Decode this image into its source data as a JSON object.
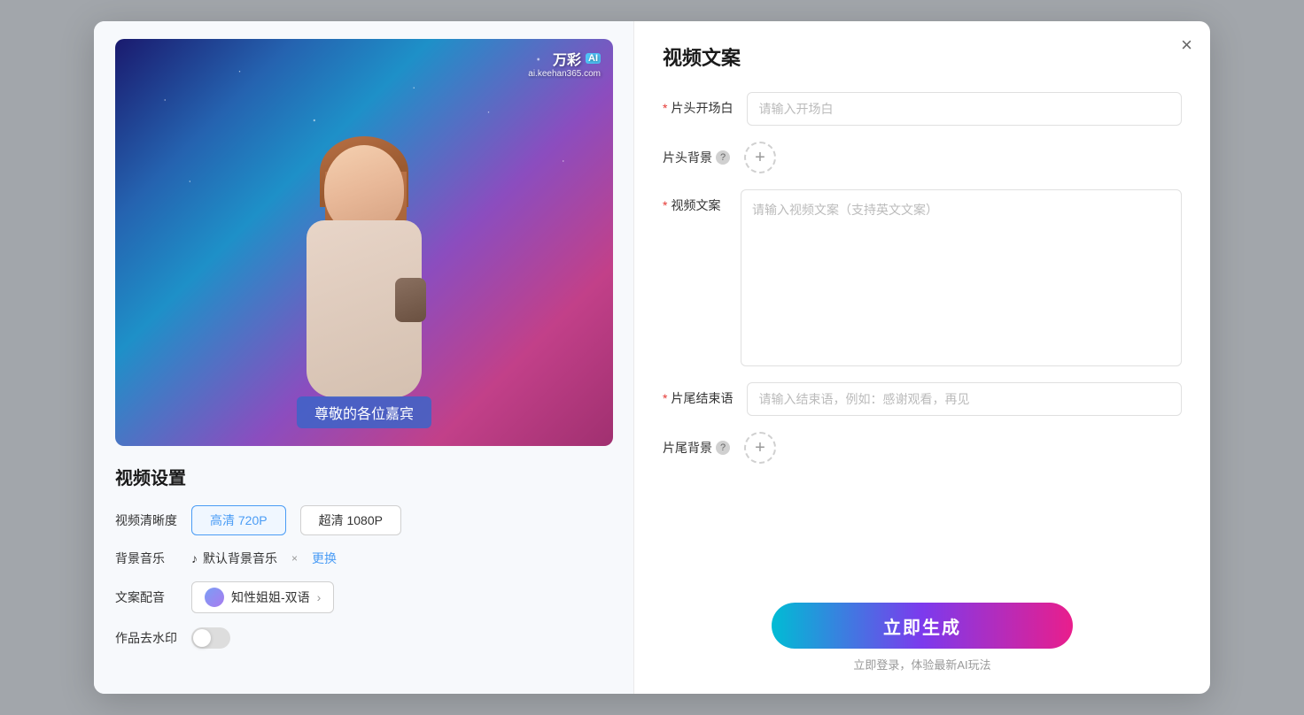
{
  "modal": {
    "close_label": "×"
  },
  "left": {
    "video_preview": {
      "watermark_brand": "万彩",
      "watermark_ai": "AI",
      "watermark_url": "ai.keehan365.com",
      "subtitle_text": "尊敬的各位嘉宾"
    },
    "settings": {
      "title": "视频设置",
      "clarity_label": "视频清晰度",
      "quality_options": [
        {
          "label": "高清 720P",
          "active": true
        },
        {
          "label": "超清 1080P",
          "active": false
        }
      ],
      "music_label": "背景音乐",
      "music_note": "♪",
      "music_name": "默认背景音乐",
      "music_close": "×",
      "music_change": "更换",
      "voice_label": "文案配音",
      "voice_name": "知性姐姐-双语",
      "watermark_label": "作品去水印"
    }
  },
  "right": {
    "title": "视频文案",
    "opening_label": "片头开场白",
    "opening_required": "*",
    "opening_placeholder": "请输入开场白",
    "background_label": "片头背景",
    "background_help": "?",
    "script_label": "视频文案",
    "script_required": "*",
    "script_placeholder": "请输入视频文案（支持英文文案）",
    "ending_label": "片尾结束语",
    "ending_required": "*",
    "ending_placeholder": "请输入结束语，例如：感谢观看，再见",
    "ending_bg_label": "片尾背景",
    "ending_bg_help": "?",
    "generate_btn": "立即生成",
    "generate_hint": "立即登录，体验最新AI玩法"
  }
}
